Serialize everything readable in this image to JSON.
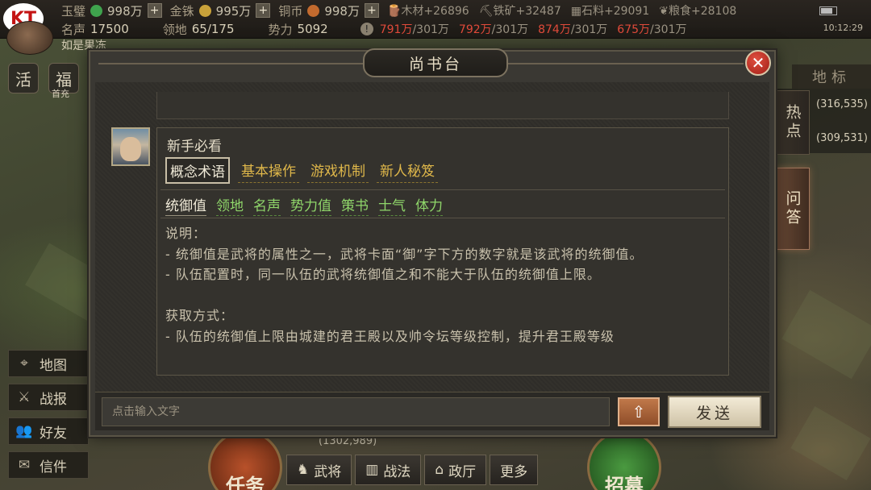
{
  "logo": "KT",
  "top": {
    "row1": [
      {
        "label": "玉璧",
        "value": "998万",
        "color": "#3fa34d"
      },
      {
        "label": "金铢",
        "value": "995万",
        "color": "#c9a23a"
      },
      {
        "label": "铜币",
        "value": "998万",
        "color": "#c26a2e"
      }
    ],
    "materials": [
      {
        "label": "木材",
        "delta": "+26896",
        "icon": "wood-icon"
      },
      {
        "label": "铁矿",
        "delta": "+32487",
        "icon": "iron-icon"
      },
      {
        "label": "石料",
        "delta": "+29091",
        "icon": "stone-icon"
      },
      {
        "label": "粮食",
        "delta": "+28108",
        "icon": "grain-icon"
      }
    ],
    "row2": {
      "fame_label": "名声",
      "fame": "17500",
      "territory_label": "领地",
      "territory": "65/175",
      "power_label": "势力",
      "power": "5092"
    },
    "storage": [
      {
        "cur": "791万",
        "max": "/301万"
      },
      {
        "cur": "792万",
        "max": "/301万"
      },
      {
        "cur": "874万",
        "max": "/301万"
      },
      {
        "cur": "675万",
        "max": "/301万"
      }
    ],
    "player_name": "如是果冻",
    "clock": "10:12:29",
    "warn": "!"
  },
  "left": {
    "round_buttons": [
      "活",
      "福"
    ],
    "round_sub": "首充",
    "menu": [
      {
        "label": "地图",
        "icon": "map-icon"
      },
      {
        "label": "战报",
        "icon": "swords-icon"
      },
      {
        "label": "好友",
        "icon": "friends-icon"
      },
      {
        "label": "信件",
        "icon": "mail-icon"
      }
    ]
  },
  "bottom": {
    "task": "任务",
    "recruit": "招募",
    "nav": [
      {
        "label": "武将",
        "icon": "general-icon"
      },
      {
        "label": "战法",
        "icon": "tactics-icon"
      },
      {
        "label": "政厅",
        "icon": "hall-icon"
      },
      {
        "label": "更多",
        "icon": ""
      }
    ],
    "location": "(1302,989)"
  },
  "right": {
    "landmark": "地标",
    "hot_tab": "热点",
    "qa_tab": "问答",
    "coords": [
      "(316,535)",
      "(309,531)"
    ]
  },
  "dialog": {
    "title": "尚书台",
    "close": "✕",
    "message_title": "新手必看",
    "categories": [
      "概念术语",
      "基本操作",
      "游戏机制",
      "新人秘笈"
    ],
    "terms": [
      "统御值",
      "领地",
      "名声",
      "势力值",
      "策书",
      "士气",
      "体力"
    ],
    "body": [
      "说明：",
      "- 统御值是武将的属性之一，武将卡面“御”字下方的数字就是该武将的统御值。",
      "- 队伍配置时，同一队伍的武将统御值之和不能大于队伍的统御值上限。",
      "",
      "获取方式：",
      "- 队伍的统御值上限由城建的君王殿以及帅令坛等级控制，提升君王殿等级"
    ],
    "input_placeholder": "点击输入文字",
    "up_arrow": "⇧",
    "send": "发送"
  }
}
